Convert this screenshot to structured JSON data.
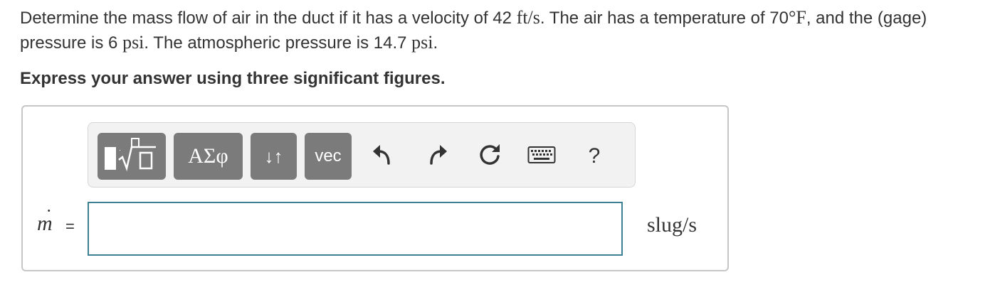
{
  "question": {
    "part1": "Determine the mass flow of air in the duct if it has a velocity of 42 ",
    "velocity_unit": "ft/s",
    "part2": ". The air has a temperature of 70",
    "temp_unit": "°F",
    "part3": ", and the (gage) pressure is 6 ",
    "gage_unit": "psi",
    "part4": ". The atmospheric pressure is 14.7 ",
    "atm_unit": "psi",
    "part5": "."
  },
  "instruction": "Express your answer using three significant figures.",
  "toolbar": {
    "greek_label": "ΑΣφ",
    "arrows_label": "↓↑",
    "vec_label": "vec",
    "help_label": "?",
    "icons": [
      "templates-icon",
      "undo-icon",
      "redo-icon",
      "reset-icon",
      "keyboard-icon"
    ]
  },
  "answer": {
    "variable": "m",
    "equals": "=",
    "value": "",
    "units": "slug/s"
  },
  "colors": {
    "toolbar_button": "#7b7b7b",
    "input_border": "#3d7f93",
    "box_border": "#c6c6c6",
    "text": "#333333"
  }
}
